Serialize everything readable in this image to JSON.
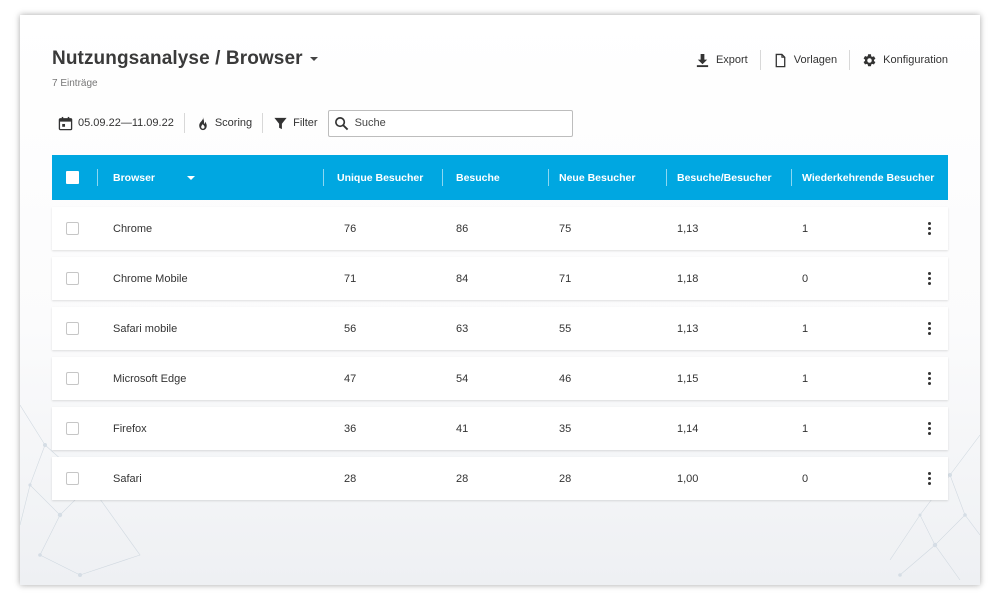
{
  "header": {
    "title": "Nutzungsanalyse / Browser",
    "entries": "7 Einträge"
  },
  "actions": {
    "export": "Export",
    "templates": "Vorlagen",
    "configuration": "Konfiguration"
  },
  "toolbar": {
    "date_range": "05.09.22—11.09.22",
    "scoring": "Scoring",
    "filter": "Filter",
    "search_placeholder": "Suche"
  },
  "table": {
    "columns": [
      "Browser",
      "Unique Besucher",
      "Besuche",
      "Neue Besucher",
      "Besuche/Besucher",
      "Wiederkehrende Besucher"
    ],
    "rows": [
      [
        "Chrome",
        "76",
        "86",
        "75",
        "1,13",
        "1"
      ],
      [
        "Chrome Mobile",
        "71",
        "84",
        "71",
        "1,18",
        "0"
      ],
      [
        "Safari mobile",
        "56",
        "63",
        "55",
        "1,13",
        "1"
      ],
      [
        "Microsoft Edge",
        "47",
        "54",
        "46",
        "1,15",
        "1"
      ],
      [
        "Firefox",
        "36",
        "41",
        "35",
        "1,14",
        "1"
      ],
      [
        "Safari",
        "28",
        "28",
        "28",
        "1,00",
        "0"
      ]
    ]
  },
  "colors": {
    "accent": "#00a7e1",
    "text": "#333333"
  },
  "icons": [
    "download-icon",
    "document-icon",
    "gear-icon",
    "calendar-icon",
    "flame-icon",
    "funnel-icon",
    "search-icon",
    "more-vert-icon"
  ]
}
